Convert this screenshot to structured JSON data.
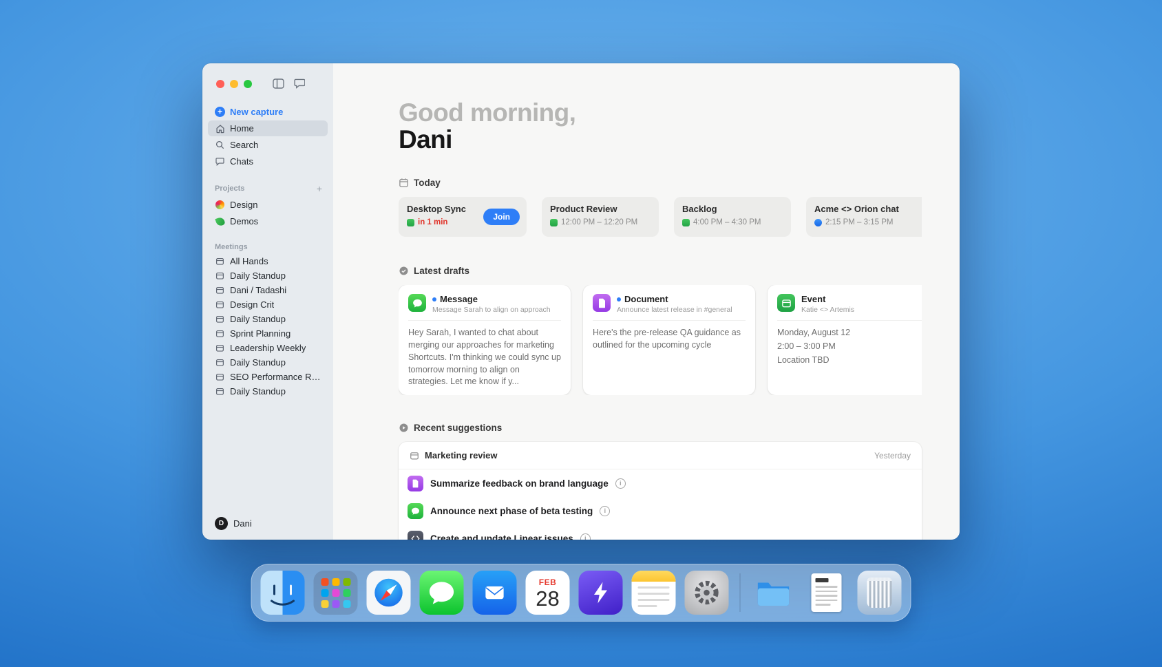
{
  "window": {
    "sidebar": {
      "new_capture_label": "New capture",
      "nav": [
        {
          "label": "Home"
        },
        {
          "label": "Search"
        },
        {
          "label": "Chats"
        }
      ],
      "projects_header": "Projects",
      "projects_add": "+",
      "projects": [
        {
          "label": "Design"
        },
        {
          "label": "Demos"
        }
      ],
      "meetings_header": "Meetings",
      "meetings": [
        {
          "label": "All Hands"
        },
        {
          "label": "Daily Standup"
        },
        {
          "label": "Dani / Tadashi"
        },
        {
          "label": "Design Crit"
        },
        {
          "label": "Daily Standup"
        },
        {
          "label": "Sprint Planning"
        },
        {
          "label": "Leadership Weekly"
        },
        {
          "label": "Daily Standup"
        },
        {
          "label": "SEO Performance Rev..."
        },
        {
          "label": "Daily Standup"
        }
      ],
      "user": {
        "initial": "D",
        "name": "Dani"
      }
    },
    "main": {
      "greeting_muted": "Good morning,",
      "greeting_name": "Dani",
      "today_label": "Today",
      "events": [
        {
          "title": "Desktop Sync",
          "time": "in 1 min",
          "join_label": "Join"
        },
        {
          "title": "Product Review",
          "time": "12:00 PM – 12:20 PM"
        },
        {
          "title": "Backlog",
          "time": "4:00 PM – 4:30 PM"
        },
        {
          "title": "Acme <> Orion chat",
          "time": "2:15 PM – 3:15 PM"
        }
      ],
      "drafts_header": "Latest drafts",
      "drafts": [
        {
          "type": "Message",
          "subtitle": "Message Sarah to align on approach",
          "body": "Hey Sarah, I wanted to chat about merging our approaches for marketing Shortcuts. I'm thinking we could sync up tomorrow morning to align on strategies. Let me know if y..."
        },
        {
          "type": "Document",
          "subtitle": "Announce latest release in #general",
          "body": "Here's the pre-release QA guidance as outlined for the upcoming cycle"
        },
        {
          "type": "Event",
          "subtitle": "Katie <> Artemis",
          "body_line1": "Monday, August 12",
          "body_line2": "2:00 – 3:00 PM",
          "body_line3": "Location TBD"
        }
      ],
      "suggestions_header": "Recent suggestions",
      "suggestions_group": {
        "title": "Marketing review",
        "time": "Yesterday"
      },
      "suggestions": [
        {
          "label": "Summarize feedback on brand language",
          "icon": "document-icon"
        },
        {
          "label": "Announce next phase of beta testing",
          "icon": "message-icon"
        },
        {
          "label": "Create and update Linear issues",
          "icon": "code-icon"
        }
      ]
    }
  },
  "colors": {
    "accent_blue": "#2e7ef7",
    "alert_red": "#e0352b",
    "calendar_green": "#2fb44c",
    "document_purple": "#a550e8",
    "message_green": "#2fbe47"
  },
  "dock": {
    "calendar_month": "FEB",
    "calendar_day": "28",
    "items": [
      {
        "name": "finder-icon"
      },
      {
        "name": "launchpad-icon"
      },
      {
        "name": "safari-icon"
      },
      {
        "name": "messages-icon"
      },
      {
        "name": "mail-icon"
      },
      {
        "name": "calendar-icon"
      },
      {
        "name": "active-app-icon"
      },
      {
        "name": "notes-icon"
      },
      {
        "name": "settings-icon"
      },
      {
        "name": "folder-icon"
      },
      {
        "name": "documents-icon"
      },
      {
        "name": "trash-icon"
      }
    ]
  }
}
